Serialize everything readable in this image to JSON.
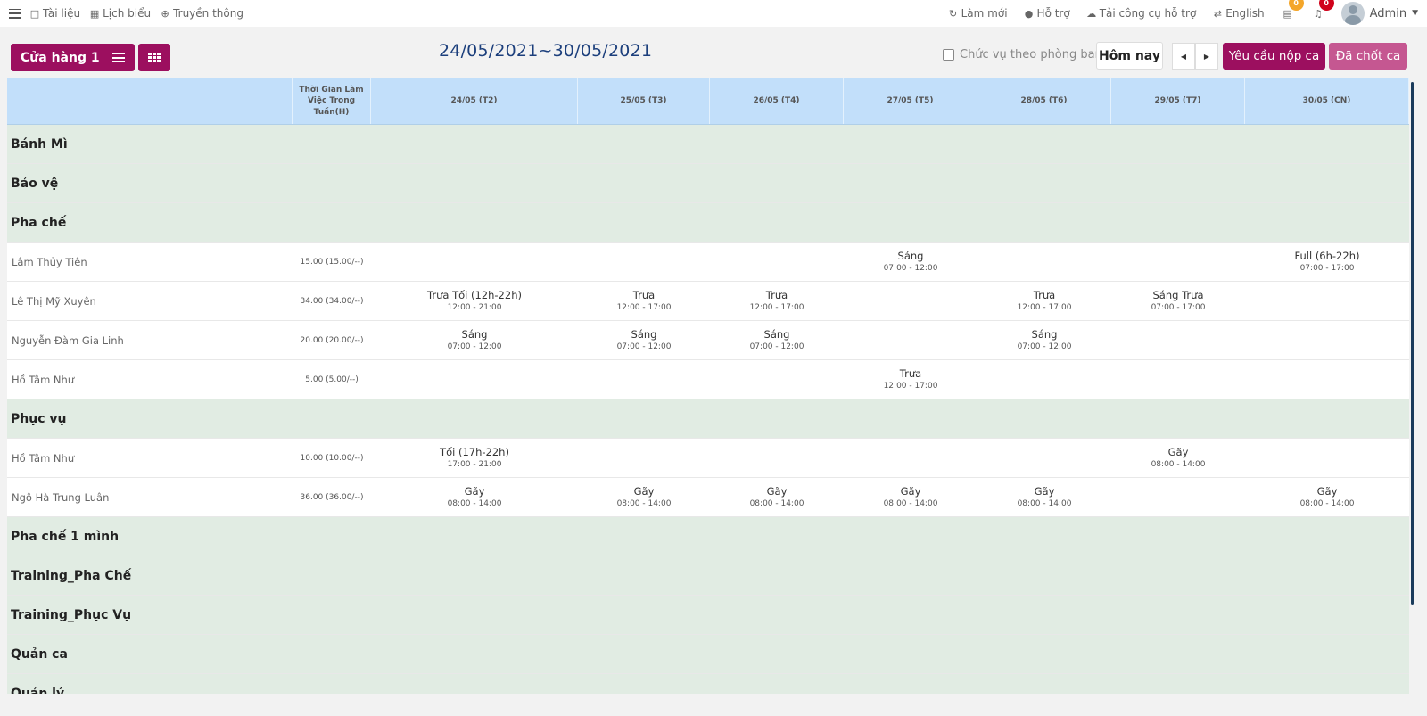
{
  "topbar": {
    "left": [
      {
        "label": "Tài liệu",
        "icon": "folder-icon",
        "glyph": "□"
      },
      {
        "label": "Lịch biểu",
        "icon": "calendar-icon",
        "glyph": "▦"
      },
      {
        "label": "Truyền thông",
        "icon": "globe-icon",
        "glyph": "⊕"
      }
    ],
    "right": [
      {
        "label": "Làm mới",
        "icon": "refresh-icon",
        "glyph": "↻"
      },
      {
        "label": "Hỗ trợ",
        "icon": "info-icon",
        "glyph": "●"
      },
      {
        "label": "Tải công cụ hỗ trợ",
        "icon": "cloud-download-icon",
        "glyph": "☁"
      },
      {
        "label": "English",
        "icon": "language-icon",
        "glyph": "⇄"
      }
    ],
    "notif_count_1": "0",
    "notif_count_2": "0",
    "user": "Admin"
  },
  "toolbar": {
    "store": "Cửa hàng 1",
    "date_range": "24/05/2021~30/05/2021",
    "checkbox_label": "Chức vụ theo phòng ban",
    "today": "Hôm nay",
    "request": "Yêu cầu nộp ca",
    "closed": "Đã chốt ca"
  },
  "table": {
    "hours_header": "Thời Gian Làm Việc Trong Tuần(H)",
    "days": [
      "24/05 (T2)",
      "25/05 (T3)",
      "26/05 (T4)",
      "27/05 (T5)",
      "28/05 (T6)",
      "29/05 (T7)",
      "30/05 (CN)"
    ],
    "rows": [
      {
        "type": "group",
        "name": "Bánh Mì"
      },
      {
        "type": "group",
        "name": "Bảo vệ"
      },
      {
        "type": "group",
        "name": "Pha chế"
      },
      {
        "type": "person",
        "name": "Lâm Thủy Tiên",
        "hours": "15.00 (15.00/--)",
        "shifts": [
          null,
          null,
          null,
          {
            "n": "Sáng",
            "t": "07:00 - 12:00"
          },
          null,
          null,
          {
            "n": "Full (6h-22h)",
            "t": "07:00 - 17:00"
          }
        ]
      },
      {
        "type": "person",
        "name": "Lê Thị Mỹ Xuyên",
        "hours": "34.00 (34.00/--)",
        "shifts": [
          {
            "n": "Trưa Tối (12h-22h)",
            "t": "12:00 - 21:00"
          },
          {
            "n": "Trưa",
            "t": "12:00 - 17:00"
          },
          {
            "n": "Trưa",
            "t": "12:00 - 17:00"
          },
          null,
          {
            "n": "Trưa",
            "t": "12:00 - 17:00"
          },
          {
            "n": "Sáng Trưa",
            "t": "07:00 - 17:00"
          },
          null
        ]
      },
      {
        "type": "person",
        "name": "Nguyễn Đàm Gia Linh",
        "hours": "20.00 (20.00/--)",
        "shifts": [
          {
            "n": "Sáng",
            "t": "07:00 - 12:00"
          },
          {
            "n": "Sáng",
            "t": "07:00 - 12:00"
          },
          {
            "n": "Sáng",
            "t": "07:00 - 12:00"
          },
          null,
          {
            "n": "Sáng",
            "t": "07:00 - 12:00"
          },
          null,
          null
        ]
      },
      {
        "type": "person",
        "name": "Hồ Tâm Như",
        "hours": "5.00 (5.00/--)",
        "shifts": [
          null,
          null,
          null,
          {
            "n": "Trưa",
            "t": "12:00 - 17:00"
          },
          null,
          null,
          null
        ]
      },
      {
        "type": "group",
        "name": "Phục vụ"
      },
      {
        "type": "person",
        "name": "Hồ Tâm Như",
        "hours": "10.00 (10.00/--)",
        "shifts": [
          {
            "n": "Tối (17h-22h)",
            "t": "17:00 - 21:00"
          },
          null,
          null,
          null,
          null,
          {
            "n": "Gãy",
            "t": "08:00 - 14:00"
          },
          null
        ]
      },
      {
        "type": "person",
        "name": "Ngô Hà Trung Luân",
        "hours": "36.00 (36.00/--)",
        "shifts": [
          {
            "n": "Gãy",
            "t": "08:00 - 14:00"
          },
          {
            "n": "Gãy",
            "t": "08:00 - 14:00"
          },
          {
            "n": "Gãy",
            "t": "08:00 - 14:00"
          },
          {
            "n": "Gãy",
            "t": "08:00 - 14:00"
          },
          {
            "n": "Gãy",
            "t": "08:00 - 14:00"
          },
          null,
          {
            "n": "Gãy",
            "t": "08:00 - 14:00"
          }
        ]
      },
      {
        "type": "group",
        "name": "Pha chế 1 mình"
      },
      {
        "type": "group",
        "name": "Training_Pha Chế"
      },
      {
        "type": "group",
        "name": "Training_Phục Vụ"
      },
      {
        "type": "group",
        "name": "Quản ca"
      },
      {
        "type": "group",
        "name": "Quản lý"
      }
    ]
  },
  "colors": {
    "brand": "#9c0f5f",
    "brand_light": "#c55791",
    "header_bg": "#c2dffa",
    "group_bg": "#e1ece3",
    "date_text": "#1c3f7c"
  }
}
